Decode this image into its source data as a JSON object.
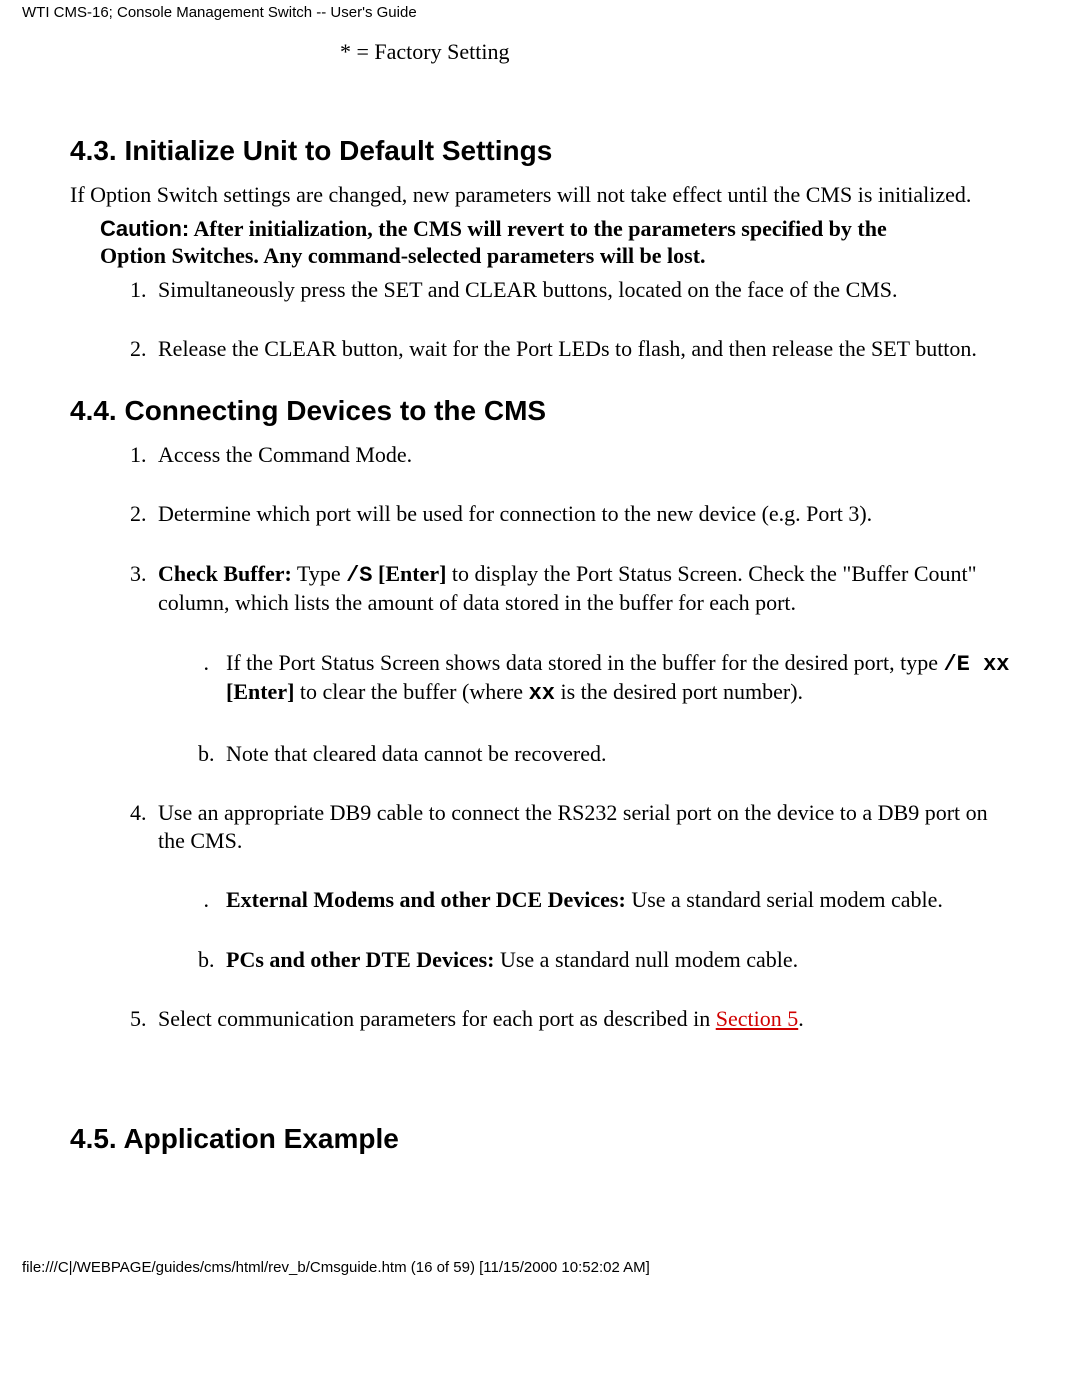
{
  "header": "WTI CMS-16; Console Management Switch -- User's Guide",
  "factory_note": "* = Factory Setting",
  "section43": {
    "heading": "4.3.   Initialize Unit to Default Settings",
    "intro": "If Option Switch settings are changed, new parameters will not take effect until the CMS is initialized.",
    "caution_label": "Caution:",
    "caution_text": "  After initialization, the CMS will revert to the parameters specified by the Option Switches.  Any command-selected parameters will be lost.",
    "step1": "Simultaneously press the SET and CLEAR buttons, located on the face of the CMS.",
    "step2": "Release the CLEAR button, wait for the Port LEDs to flash, and then release the SET button."
  },
  "section44": {
    "heading": "4.4.   Connecting Devices to the CMS",
    "step1": "Access the Command Mode.",
    "step2": "Determine which port will be used for connection to the new device (e.g. Port 3).",
    "step3_label": "Check Buffer:",
    "step3_a": " Type ",
    "step3_cmd1": "/S",
    "step3_enter1": " [Enter]",
    "step3_b": " to display the Port Status Screen. Check the \"Buffer Count\" column, which lists the amount of data stored in the buffer for each port.",
    "step3_sub_a_pre": "If the Port Status Screen shows data stored in the buffer for the desired port, type ",
    "step3_sub_a_cmd": "/E  xx",
    "step3_sub_a_enter": " [Enter]",
    "step3_sub_a_mid": " to clear the buffer (where ",
    "step3_sub_a_xx": "xx",
    "step3_sub_a_end": " is the desired port number).",
    "step3_sub_b": "Note that cleared data cannot be recovered.",
    "step4": "Use an appropriate DB9 cable to connect the RS232 serial port on the device to a DB9 port on the CMS.",
    "step4_sub_a_label": "External Modems and other DCE Devices:",
    "step4_sub_a_text": "  Use a standard serial modem cable.",
    "step4_sub_b_label": "PCs and other DTE Devices:",
    "step4_sub_b_text": "  Use a standard null modem cable.",
    "step5_pre": "Select communication parameters for each port as described in ",
    "step5_link": "Section 5",
    "step5_post": "."
  },
  "section45": {
    "heading": "4.5.   Application Example"
  },
  "footer": "file:///C|/WEBPAGE/guides/cms/html/rev_b/Cmsguide.htm (16 of 59) [11/15/2000 10:52:02 AM]"
}
